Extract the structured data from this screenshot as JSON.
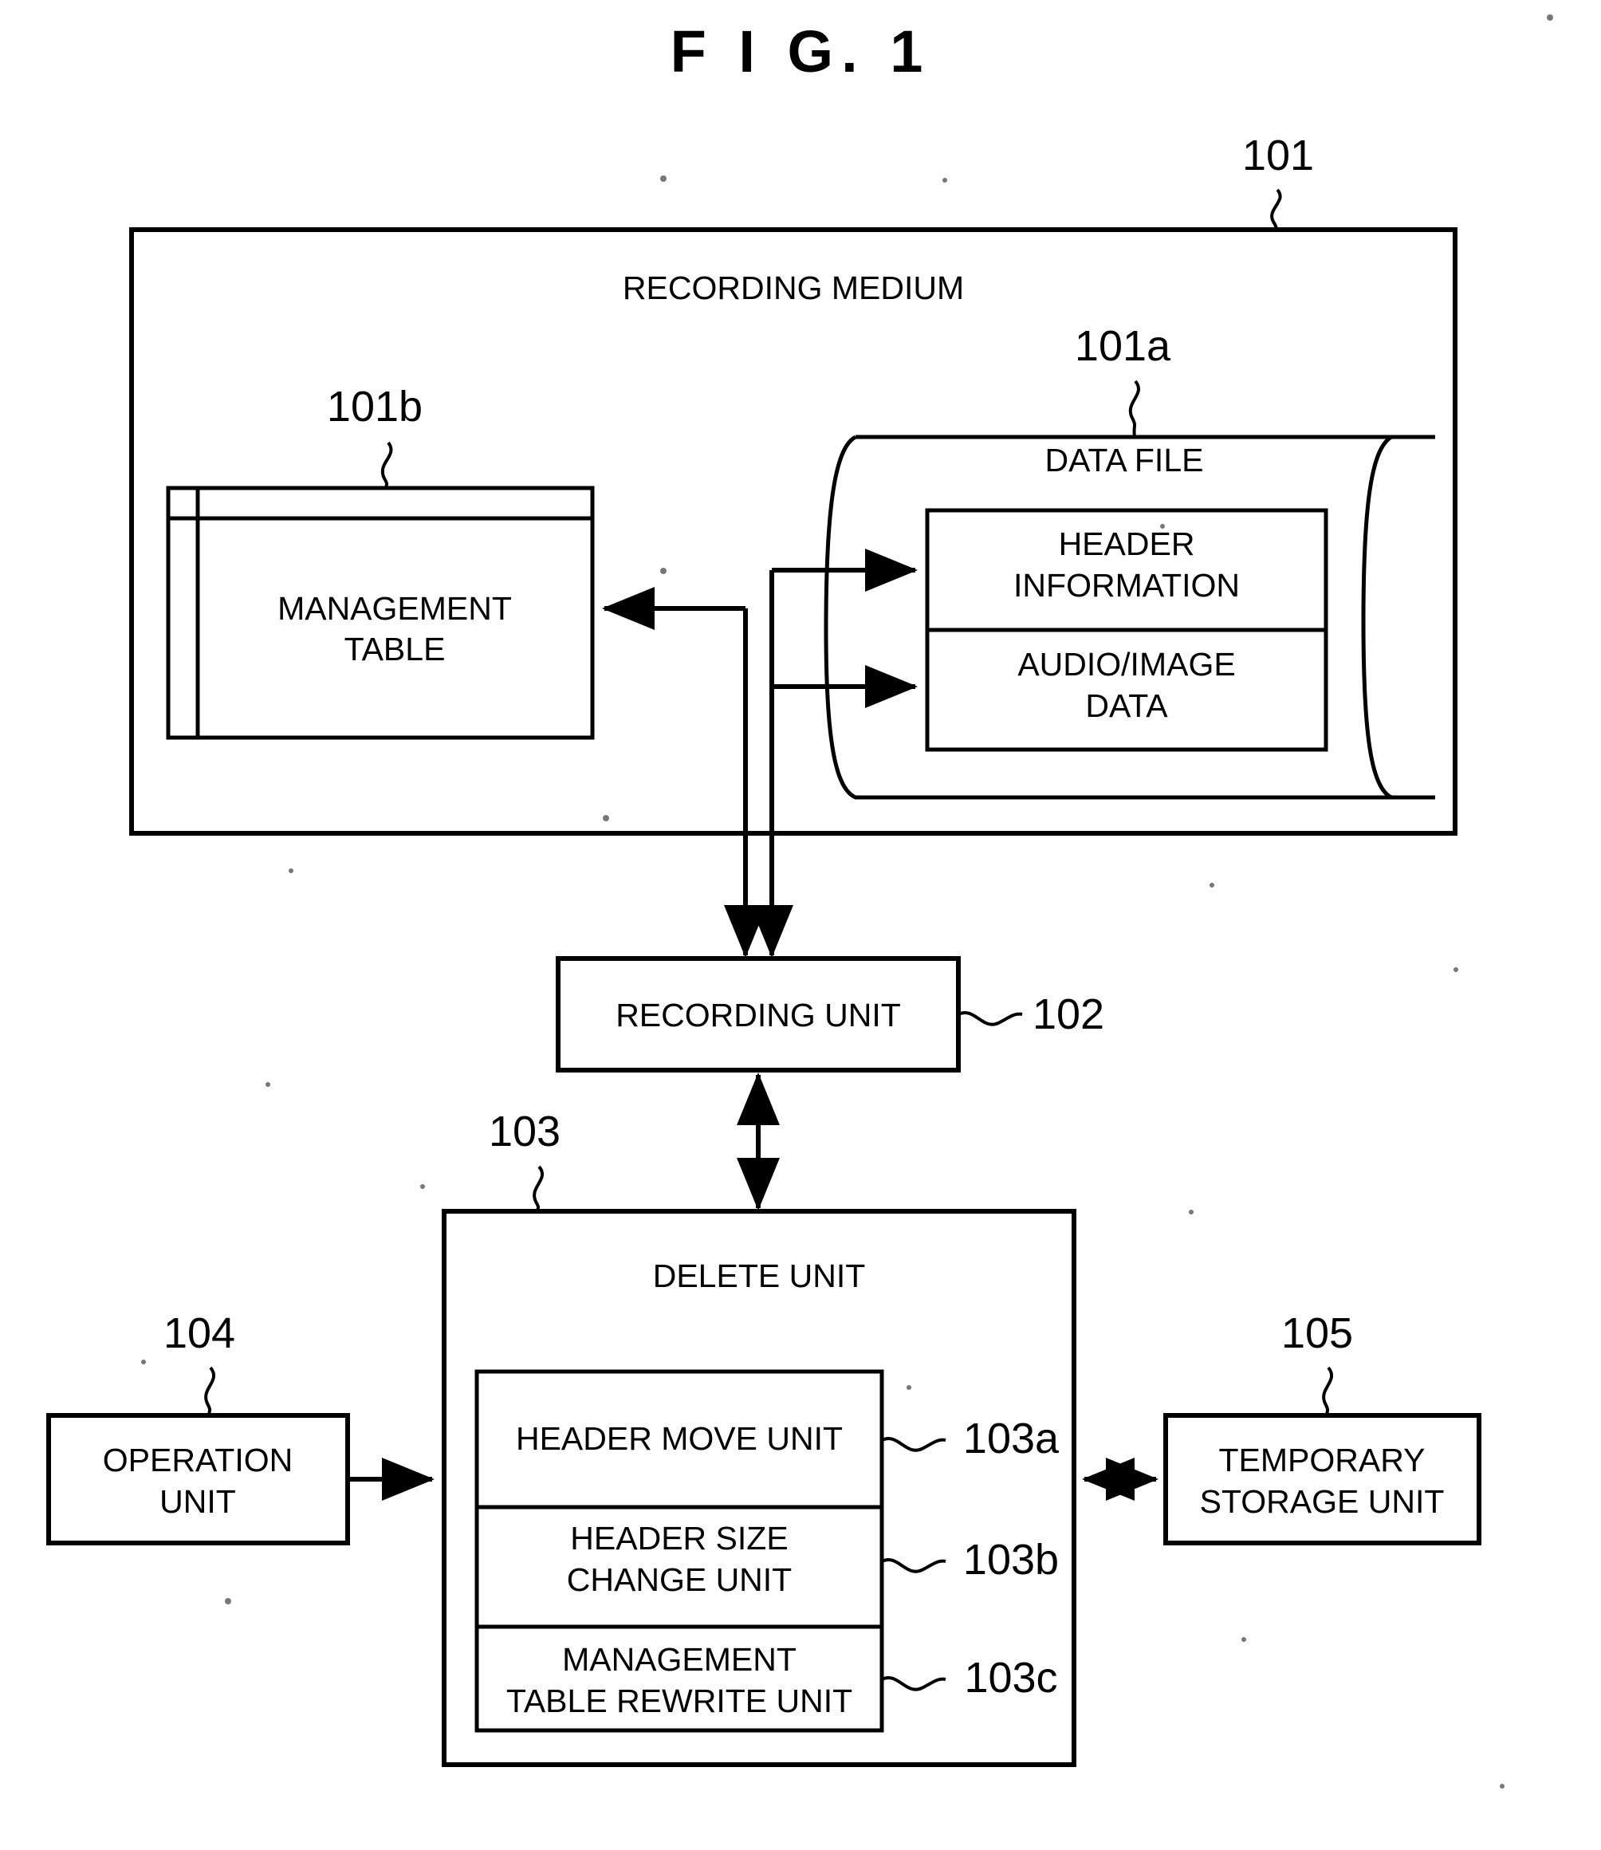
{
  "figure": {
    "title": "F I G.  1"
  },
  "blocks": {
    "recording_medium": {
      "label": "RECORDING MEDIUM",
      "ref": "101"
    },
    "management_table": {
      "label_line1": "MANAGEMENT",
      "label_line2": "TABLE",
      "ref": "101b"
    },
    "data_file": {
      "label": "DATA FILE",
      "ref": "101a",
      "rows": [
        {
          "line1": "HEADER",
          "line2": "INFORMATION"
        },
        {
          "line1": "AUDIO/IMAGE",
          "line2": "DATA"
        }
      ]
    },
    "recording_unit": {
      "label": "RECORDING UNIT",
      "ref": "102"
    },
    "delete_unit": {
      "label": "DELETE UNIT",
      "ref": "103",
      "subunits": [
        {
          "line1": "HEADER MOVE UNIT",
          "line2": "",
          "ref": "103a"
        },
        {
          "line1": "HEADER SIZE",
          "line2": "CHANGE UNIT",
          "ref": "103b"
        },
        {
          "line1": "MANAGEMENT",
          "line2": "TABLE REWRITE UNIT",
          "ref": "103c"
        }
      ]
    },
    "operation_unit": {
      "label_line1": "OPERATION",
      "label_line2": "UNIT",
      "ref": "104"
    },
    "temporary_storage_unit": {
      "label_line1": "TEMPORARY",
      "label_line2": "STORAGE UNIT",
      "ref": "105"
    }
  },
  "colors": {
    "stroke": "#000000",
    "background": "#ffffff"
  }
}
